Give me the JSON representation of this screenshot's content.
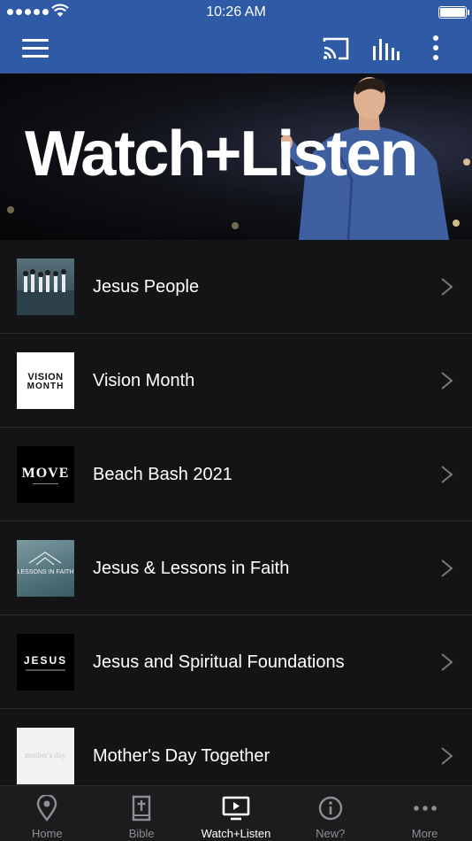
{
  "status_bar": {
    "time": "10:26 AM"
  },
  "app_bar": {
    "menu_icon": "hamburger-menu-icon",
    "cast_icon": "cast-icon",
    "audio_icon": "audio-bars-icon",
    "overflow_icon": "more-vertical-icon",
    "background_color": "#2f5aa6"
  },
  "hero": {
    "title": "Watch+Listen"
  },
  "series": [
    {
      "label": "Jesus People",
      "thumb": "th-people"
    },
    {
      "label": "Vision Month",
      "thumb": "th-vision",
      "thumb_text": [
        "VISION",
        "MONTH"
      ]
    },
    {
      "label": "Beach Bash 2021",
      "thumb": "th-move",
      "thumb_text": "MOVE"
    },
    {
      "label": "Jesus & Lessons in Faith",
      "thumb": "th-lessons",
      "thumb_text": "LESSONS IN FAITH"
    },
    {
      "label": "Jesus and Spiritual Foundations",
      "thumb": "th-jesus",
      "thumb_text": "JESUS"
    },
    {
      "label": "Mother's Day Together",
      "thumb": "th-mothers",
      "thumb_text": "mother's day"
    }
  ],
  "tabs": [
    {
      "label": "Home",
      "icon": "map-pin-icon",
      "active": false
    },
    {
      "label": "Bible",
      "icon": "bible-icon",
      "active": false
    },
    {
      "label": "Watch+Listen",
      "icon": "tv-play-icon",
      "active": true
    },
    {
      "label": "New?",
      "icon": "info-icon",
      "active": false
    },
    {
      "label": "More",
      "icon": "more-horizontal-icon",
      "active": false
    }
  ],
  "colors": {
    "background": "#141416",
    "tabbar": "#1c1c1e",
    "tab_inactive": "#8e8e93",
    "tab_active": "#ffffff"
  }
}
